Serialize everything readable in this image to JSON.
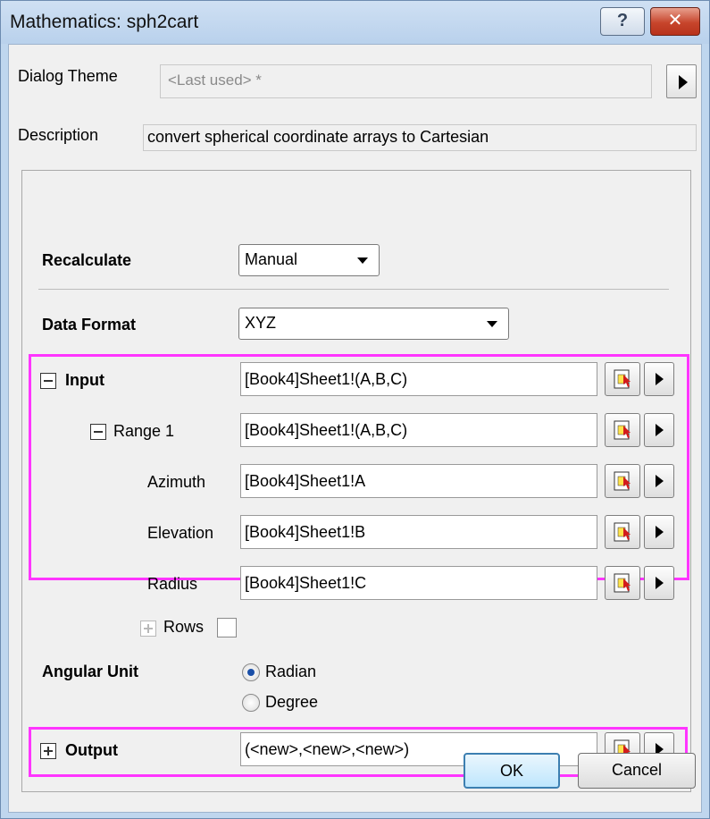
{
  "window": {
    "title": "Mathematics: sph2cart",
    "help_label": "?",
    "close_label": "✕"
  },
  "theme": {
    "label": "Dialog Theme",
    "value": "<Last used> *"
  },
  "description": {
    "label": "Description",
    "value": "convert spherical coordinate arrays to Cartesian"
  },
  "recalculate": {
    "label": "Recalculate",
    "value": "Manual"
  },
  "data_format": {
    "label": "Data Format",
    "value": "XYZ"
  },
  "input": {
    "label": "Input",
    "value": "[Book4]Sheet1!(A,B,C)",
    "range": {
      "label": "Range 1",
      "value": "[Book4]Sheet1!(A,B,C)",
      "azimuth": {
        "label": "Azimuth",
        "value": "[Book4]Sheet1!A"
      },
      "elevation": {
        "label": "Elevation",
        "value": "[Book4]Sheet1!B"
      },
      "radius": {
        "label": "Radius",
        "value": "[Book4]Sheet1!C"
      }
    }
  },
  "rows": {
    "label": "Rows",
    "checked": false
  },
  "angular_unit": {
    "label": "Angular Unit",
    "options": [
      "Radian",
      "Degree"
    ],
    "selected": "Radian"
  },
  "output": {
    "label": "Output",
    "value": "(<new>,<new>,<new>)"
  },
  "buttons": {
    "ok": "OK",
    "cancel": "Cancel"
  },
  "colors": {
    "highlight": "#ff35ff",
    "titlebar": "#bfd6ee",
    "close": "#c7452c"
  }
}
